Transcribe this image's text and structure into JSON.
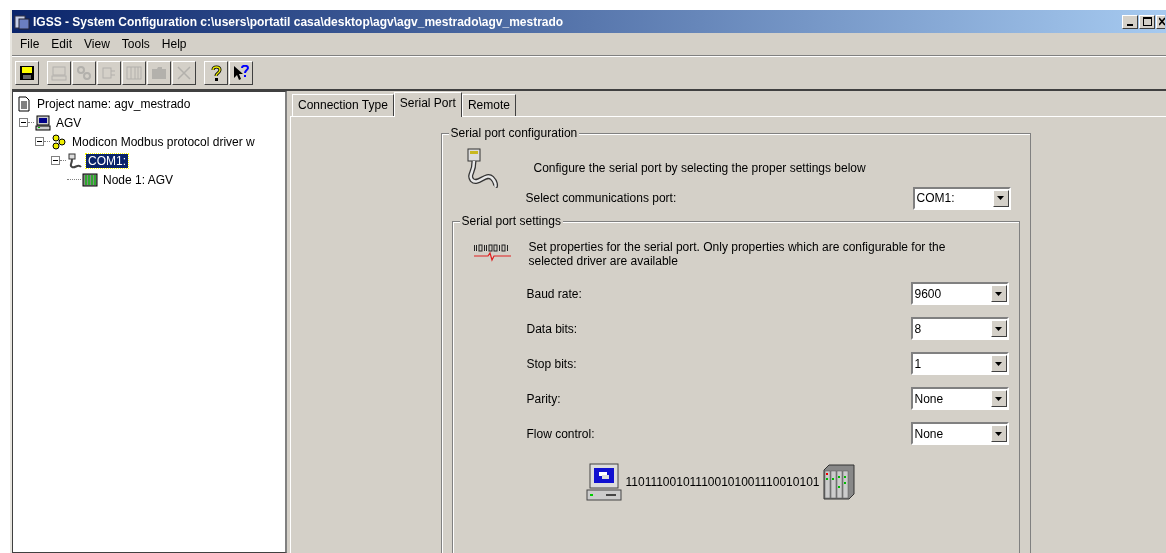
{
  "window": {
    "title": "IGSS -  System Configuration c:\\users\\portatil casa\\desktop\\agv\\agv_mestrado\\agv_mestrado"
  },
  "menu": [
    "File",
    "Edit",
    "View",
    "Tools",
    "Help"
  ],
  "toolbar": [
    {
      "kind": "save",
      "disabled": false
    },
    {
      "kind": "station",
      "disabled": true
    },
    {
      "kind": "driver",
      "disabled": true
    },
    {
      "kind": "port",
      "disabled": true
    },
    {
      "kind": "node",
      "disabled": true
    },
    {
      "kind": "folder",
      "disabled": true
    },
    {
      "kind": "delete",
      "disabled": true
    },
    {
      "kind": "help",
      "disabled": false
    },
    {
      "kind": "context-help",
      "disabled": false
    }
  ],
  "tree": [
    {
      "kind": "project",
      "label": "Project name: agv_mestrado",
      "selected": false
    },
    {
      "kind": "station",
      "label": "AGV",
      "selected": false,
      "expanded": true,
      "children": [
        {
          "kind": "driver",
          "label": "Modicon Modbus protocol driver w",
          "selected": false,
          "expanded": true,
          "children": [
            {
              "kind": "port",
              "label": "COM1:",
              "selected": true,
              "expanded": true,
              "children": [
                {
                  "kind": "node",
                  "label": "Node 1: AGV",
                  "selected": false
                }
              ]
            }
          ]
        }
      ]
    }
  ],
  "tabs": [
    {
      "label": "Connection Type",
      "selected": false
    },
    {
      "label": "Serial Port",
      "selected": true
    },
    {
      "label": "Remote",
      "selected": false
    }
  ],
  "config_group": {
    "title": "Serial port configuration",
    "description": "Configure the serial port by selecting the proper settings below",
    "port_label": "Select communications port:",
    "port_value": "COM1:"
  },
  "settings_group": {
    "title": "Serial port settings",
    "description": "Set properties for the serial port. Only properties which are configurable for the selected driver are available",
    "fields": [
      {
        "label": "Baud rate:",
        "value": "9600"
      },
      {
        "label": "Data bits:",
        "value": "8"
      },
      {
        "label": "Stop bits:",
        "value": "1"
      },
      {
        "label": "Parity:",
        "value": "None"
      },
      {
        "label": "Flow control:",
        "value": "None"
      }
    ],
    "bitstream": "110111001011100101001110010101"
  }
}
